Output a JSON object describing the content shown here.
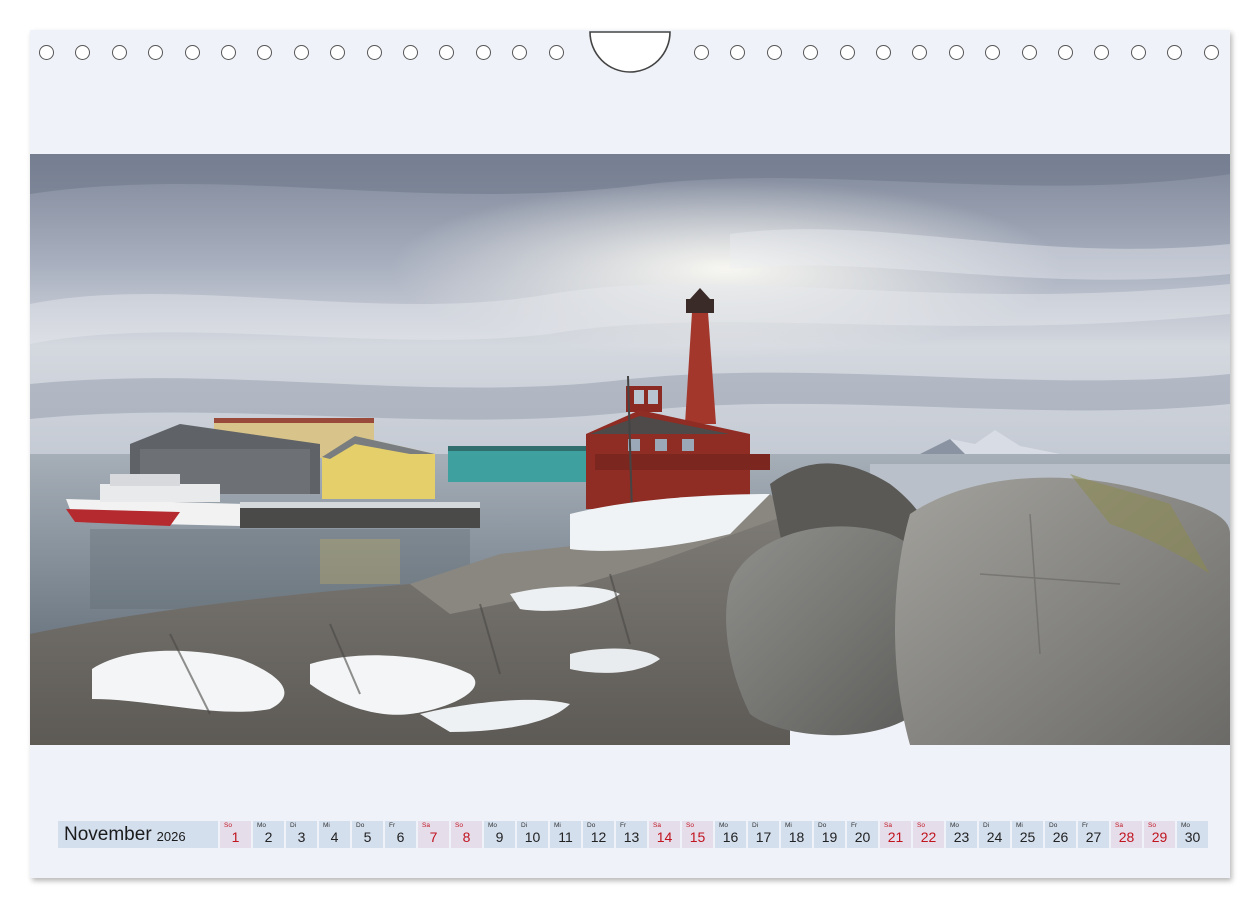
{
  "calendar": {
    "month": "November",
    "year": "2026",
    "days": [
      {
        "wd": "So",
        "n": "1",
        "we": true
      },
      {
        "wd": "Mo",
        "n": "2",
        "we": false
      },
      {
        "wd": "Di",
        "n": "3",
        "we": false
      },
      {
        "wd": "Mi",
        "n": "4",
        "we": false
      },
      {
        "wd": "Do",
        "n": "5",
        "we": false
      },
      {
        "wd": "Fr",
        "n": "6",
        "we": false
      },
      {
        "wd": "Sa",
        "n": "7",
        "we": true
      },
      {
        "wd": "So",
        "n": "8",
        "we": true
      },
      {
        "wd": "Mo",
        "n": "9",
        "we": false
      },
      {
        "wd": "Di",
        "n": "10",
        "we": false
      },
      {
        "wd": "Mi",
        "n": "11",
        "we": false
      },
      {
        "wd": "Do",
        "n": "12",
        "we": false
      },
      {
        "wd": "Fr",
        "n": "13",
        "we": false
      },
      {
        "wd": "Sa",
        "n": "14",
        "we": true
      },
      {
        "wd": "So",
        "n": "15",
        "we": true
      },
      {
        "wd": "Mo",
        "n": "16",
        "we": false
      },
      {
        "wd": "Di",
        "n": "17",
        "we": false
      },
      {
        "wd": "Mi",
        "n": "18",
        "we": false
      },
      {
        "wd": "Do",
        "n": "19",
        "we": false
      },
      {
        "wd": "Fr",
        "n": "20",
        "we": false
      },
      {
        "wd": "Sa",
        "n": "21",
        "we": true
      },
      {
        "wd": "So",
        "n": "22",
        "we": true
      },
      {
        "wd": "Mo",
        "n": "23",
        "we": false
      },
      {
        "wd": "Di",
        "n": "24",
        "we": false
      },
      {
        "wd": "Mi",
        "n": "25",
        "we": false
      },
      {
        "wd": "Do",
        "n": "26",
        "we": false
      },
      {
        "wd": "Fr",
        "n": "27",
        "we": false
      },
      {
        "wd": "Sa",
        "n": "28",
        "we": true
      },
      {
        "wd": "So",
        "n": "29",
        "we": true
      },
      {
        "wd": "Mo",
        "n": "30",
        "we": false
      }
    ]
  },
  "colors": {
    "page_background": "#eff2f8",
    "cell_background": "#d4dfee",
    "weekend_text": "#c0141f"
  }
}
